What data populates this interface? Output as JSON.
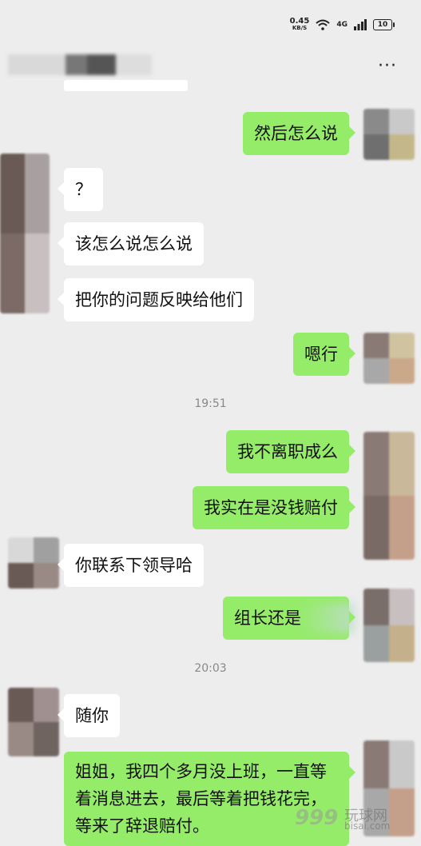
{
  "status_bar": {
    "speed": "0.45",
    "speed_unit": "KB/S",
    "network": "4G",
    "battery": "10"
  },
  "header": {
    "more_icon": "more-dots-icon"
  },
  "timestamps": [
    "19:51",
    "20:03"
  ],
  "messages": [
    {
      "side": "out",
      "text": "然后怎么说"
    },
    {
      "side": "in",
      "text": "？"
    },
    {
      "side": "in",
      "text": "该怎么说怎么说"
    },
    {
      "side": "in",
      "text": "把你的问题反映给他们"
    },
    {
      "side": "out",
      "text": "嗯行"
    },
    {
      "side": "out",
      "text": "我不离职成么"
    },
    {
      "side": "out",
      "text": "我实在是没钱赔付"
    },
    {
      "side": "in",
      "text": "你联系下领导哈"
    },
    {
      "side": "out",
      "text": "组长还是"
    },
    {
      "side": "in",
      "text": "随你"
    },
    {
      "side": "out",
      "text": "姐姐，我四个多月没上班，一直等着消息进去，最后等着把钱花完，等来了辞退赔付。"
    }
  ],
  "watermark": {
    "logo": "999",
    "text": "玩球网",
    "domain": "bisai.com"
  },
  "colors": {
    "background": "#ededed",
    "outgoing_bubble": "#95ec69",
    "incoming_bubble": "#ffffff"
  }
}
